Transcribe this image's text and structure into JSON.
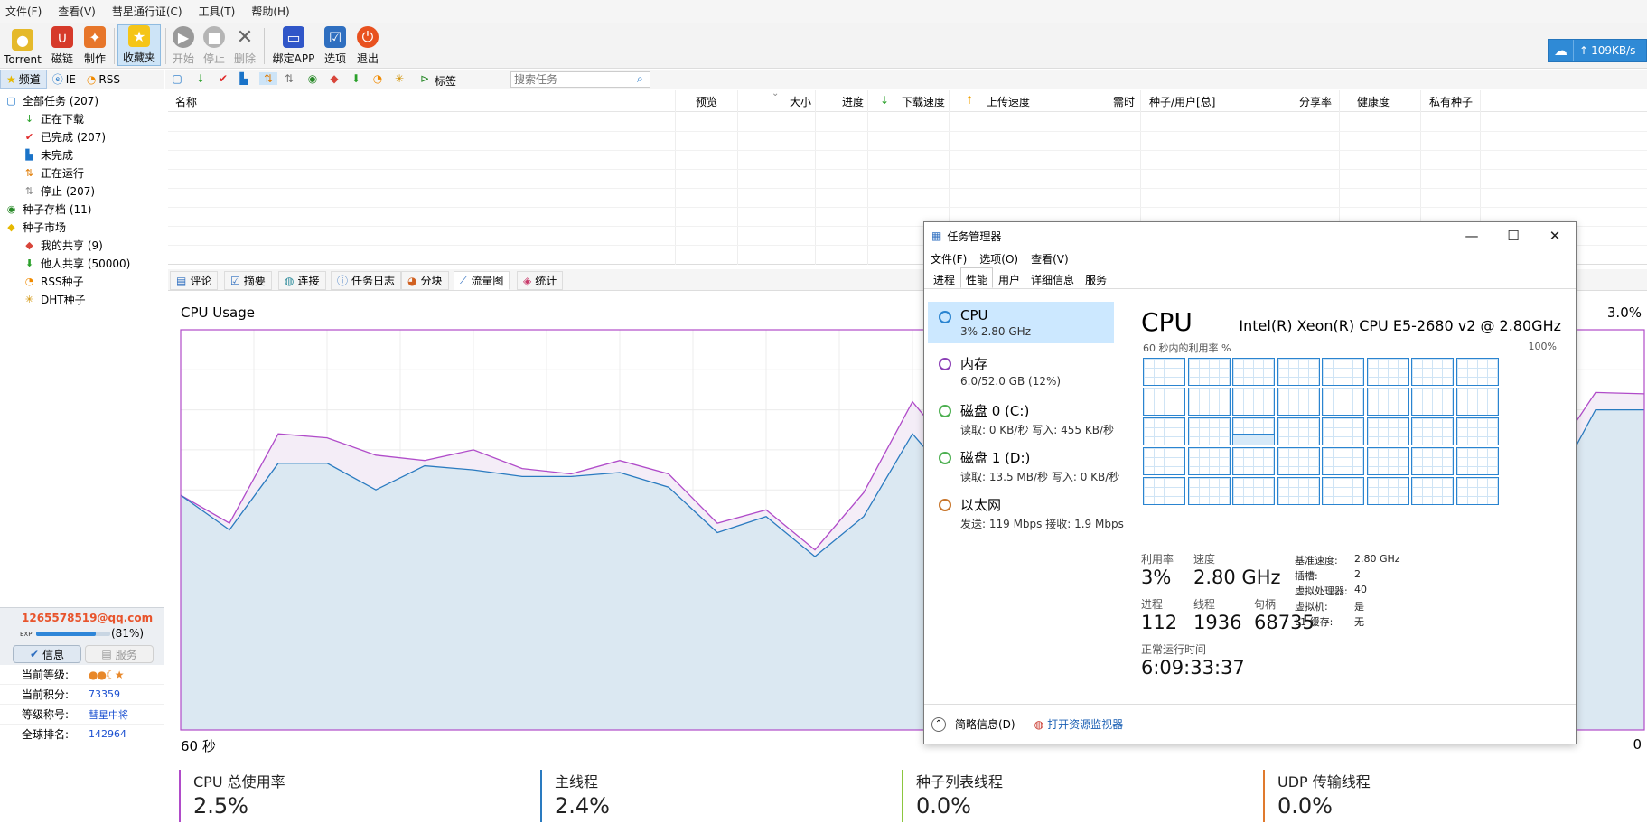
{
  "menu": [
    "文件(F)",
    "查看(V)",
    "彗星通行证(C)",
    "工具(T)",
    "帮助(H)"
  ],
  "toolbar": {
    "torrent": "Torrent",
    "magnet": "磁链",
    "make": "制作",
    "favorites": "收藏夹",
    "start": "开始",
    "stop": "停止",
    "delete": "删除",
    "bind_app": "绑定APP",
    "options": "选项",
    "exit": "退出"
  },
  "speed": "109KB/s",
  "sidebar": {
    "tabs": [
      "频道",
      "IE",
      "RSS"
    ],
    "tree": [
      {
        "label": "全部任务 (207)",
        "indent": 0,
        "icon": "all-tasks"
      },
      {
        "label": "正在下载",
        "indent": 1,
        "icon": "downloading"
      },
      {
        "label": "已完成 (207)",
        "indent": 1,
        "icon": "completed"
      },
      {
        "label": "未完成",
        "indent": 1,
        "icon": "incomplete"
      },
      {
        "label": "正在运行",
        "indent": 1,
        "icon": "running"
      },
      {
        "label": "停止 (207)",
        "indent": 1,
        "icon": "stopped"
      },
      {
        "label": "种子存档 (11)",
        "indent": 0,
        "icon": "archive"
      },
      {
        "label": "种子市场",
        "indent": 0,
        "icon": "market"
      },
      {
        "label": "我的共享 (9)",
        "indent": 1,
        "icon": "my-share"
      },
      {
        "label": "他人共享 (50000)",
        "indent": 1,
        "icon": "others-share"
      },
      {
        "label": "RSS种子",
        "indent": 1,
        "icon": "rss"
      },
      {
        "label": "DHT种子",
        "indent": 1,
        "icon": "dht"
      }
    ]
  },
  "user": {
    "email": "1265578519@qq.com",
    "exp_label": "EXP",
    "exp_pct": "(81%)",
    "exp_fraction": 0.81,
    "tab_info": "信息",
    "tab_service": "服务",
    "rows": [
      {
        "k": "当前等级:",
        "v": ""
      },
      {
        "k": "当前积分:",
        "v": "73359"
      },
      {
        "k": "等级称号:",
        "v": "彗星中将"
      },
      {
        "k": "全球排名:",
        "v": "142964"
      }
    ]
  },
  "secbar": {
    "tag_label": "标签",
    "search_placeholder": "搜索任务"
  },
  "grid": {
    "columns": [
      "名称",
      "预览",
      "大小",
      "进度",
      "下载速度",
      "上传速度",
      "需时",
      "种子/用户[总]",
      "分享率",
      "健康度",
      "私有种子"
    ]
  },
  "bottom_tabs": [
    "评论",
    "摘要",
    "连接",
    "任务日志",
    "分块",
    "流量图",
    "统计"
  ],
  "chart": {
    "title": "CPU Usage",
    "max_label": "3.0%",
    "x_left": "60 秒",
    "x_right": "0"
  },
  "chart_data": {
    "type": "area",
    "title": "CPU Usage",
    "xlabel": "",
    "ylabel": "",
    "xlim": [
      60,
      0
    ],
    "ylim": [
      0,
      3.0
    ],
    "x": [
      60,
      58,
      56,
      54,
      52,
      50,
      48,
      46,
      44,
      42,
      40,
      38,
      36,
      34,
      32,
      30,
      28,
      26,
      24,
      22,
      20,
      18,
      16,
      14,
      12,
      10,
      8,
      6,
      4,
      2,
      0
    ],
    "series": [
      {
        "name": "CPU 总使用率",
        "values": [
          1.76,
          1.55,
          2.22,
          2.19,
          2.06,
          2.02,
          2.1,
          1.96,
          1.92,
          2.02,
          1.92,
          1.55,
          1.65,
          1.35,
          1.78,
          2.46,
          2.02,
          1.76,
          1.82,
          1.9,
          1.86,
          2.3,
          2.12,
          2.25,
          2.06,
          1.93,
          1.98,
          2.1,
          1.98,
          2.53,
          2.52
        ]
      },
      {
        "name": "主线程",
        "values": [
          1.76,
          1.5,
          2.0,
          2.0,
          1.8,
          1.98,
          1.95,
          1.9,
          1.9,
          1.93,
          1.82,
          1.48,
          1.6,
          1.3,
          1.6,
          2.22,
          1.8,
          1.62,
          1.7,
          1.8,
          1.75,
          2.15,
          1.95,
          2.08,
          1.9,
          1.8,
          1.86,
          1.98,
          1.72,
          2.4,
          2.4
        ]
      }
    ]
  },
  "legend": [
    {
      "name": "CPU 总使用率",
      "value": "2.5%",
      "color": "#b04bc9"
    },
    {
      "name": "主线程",
      "value": "2.4%",
      "color": "#2a7bc0"
    },
    {
      "name": "种子列表线程",
      "value": "0.0%",
      "color": "#8cc63f"
    },
    {
      "name": "UDP 传输线程",
      "value": "0.0%",
      "color": "#e07a2e"
    }
  ],
  "tm": {
    "title": "任务管理器",
    "menu": [
      "文件(F)",
      "选项(O)",
      "查看(V)"
    ],
    "tabs": [
      "进程",
      "性能",
      "用户",
      "详细信息",
      "服务"
    ],
    "items": [
      {
        "title": "CPU",
        "sub": "3% 2.80 GHz",
        "color": "#2a84d0"
      },
      {
        "title": "内存",
        "sub": "6.0/52.0 GB (12%)",
        "color": "#8b3fb5"
      },
      {
        "title": "磁盘 0 (C:)",
        "sub": "读取: 0 KB/秒 写入: 455 KB/秒",
        "color": "#4caf50"
      },
      {
        "title": "磁盘 1 (D:)",
        "sub": "读取: 13.5 MB/秒 写入: 0 KB/秒",
        "color": "#4caf50"
      },
      {
        "title": "以太网",
        "sub": "发送: 119 Mbps 接收: 1.9 Mbps",
        "color": "#c8752a"
      }
    ],
    "cpu_title": "CPU",
    "cpu_model": "Intel(R) Xeon(R) CPU E5-2680 v2 @ 2.80GHz",
    "graph_label": "60 秒内的利用率 %",
    "graph_max": "100%",
    "stats": {
      "util_k": "利用率",
      "util_v": "3%",
      "speed_k": "速度",
      "speed_v": "2.80 GHz",
      "proc_k": "进程",
      "proc_v": "112",
      "thread_k": "线程",
      "thread_v": "1936",
      "handle_k": "句柄",
      "handle_v": "68735",
      "uptime_k": "正常运行时间",
      "uptime_v": "6:09:33:37"
    },
    "specs": [
      {
        "k": "基准速度:",
        "v": "2.80 GHz"
      },
      {
        "k": "插槽:",
        "v": "2"
      },
      {
        "k": "虚拟处理器:",
        "v": "40"
      },
      {
        "k": "虚拟机:",
        "v": "是"
      },
      {
        "k": "L1 缓存:",
        "v": "无"
      }
    ],
    "footer_less": "简略信息(D)",
    "footer_monitor": "打开资源监视器"
  }
}
